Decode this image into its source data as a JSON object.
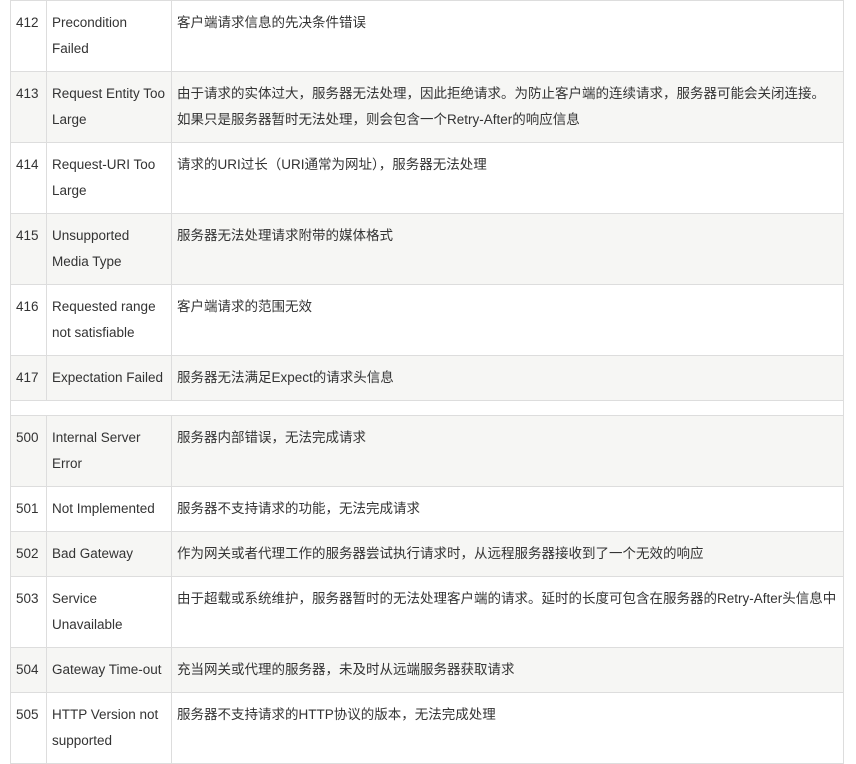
{
  "rows_4xx": [
    {
      "code": "412",
      "name": "Precondition Failed",
      "desc": "客户端请求信息的先决条件错误"
    },
    {
      "code": "413",
      "name": "Request Entity Too Large",
      "desc": "由于请求的实体过大，服务器无法处理，因此拒绝请求。为防止客户端的连续请求，服务器可能会关闭连接。如果只是服务器暂时无法处理，则会包含一个Retry-After的响应信息"
    },
    {
      "code": "414",
      "name": "Request-URI Too Large",
      "desc": "请求的URI过长（URI通常为网址），服务器无法处理"
    },
    {
      "code": "415",
      "name": "Unsupported Media Type",
      "desc": "服务器无法处理请求附带的媒体格式"
    },
    {
      "code": "416",
      "name": "Requested range not satisfiable",
      "desc": "客户端请求的范围无效"
    },
    {
      "code": "417",
      "name": "Expectation Failed",
      "desc": "服务器无法满足Expect的请求头信息"
    }
  ],
  "rows_5xx": [
    {
      "code": "500",
      "name": "Internal Server Error",
      "desc": "服务器内部错误，无法完成请求"
    },
    {
      "code": "501",
      "name": "Not Implemented",
      "desc": "服务器不支持请求的功能，无法完成请求"
    },
    {
      "code": "502",
      "name": "Bad Gateway",
      "desc": "作为网关或者代理工作的服务器尝试执行请求时，从远程服务器接收到了一个无效的响应"
    },
    {
      "code": "503",
      "name": "Service Unavailable",
      "desc": "由于超载或系统维护，服务器暂时的无法处理客户端的请求。延时的长度可包含在服务器的Retry-After头信息中"
    },
    {
      "code": "504",
      "name": "Gateway Time-out",
      "desc": "充当网关或代理的服务器，未及时从远端服务器获取请求"
    },
    {
      "code": "505",
      "name": "HTTP Version not supported",
      "desc": "服务器不支持请求的HTTP协议的版本，无法完成处理"
    }
  ]
}
